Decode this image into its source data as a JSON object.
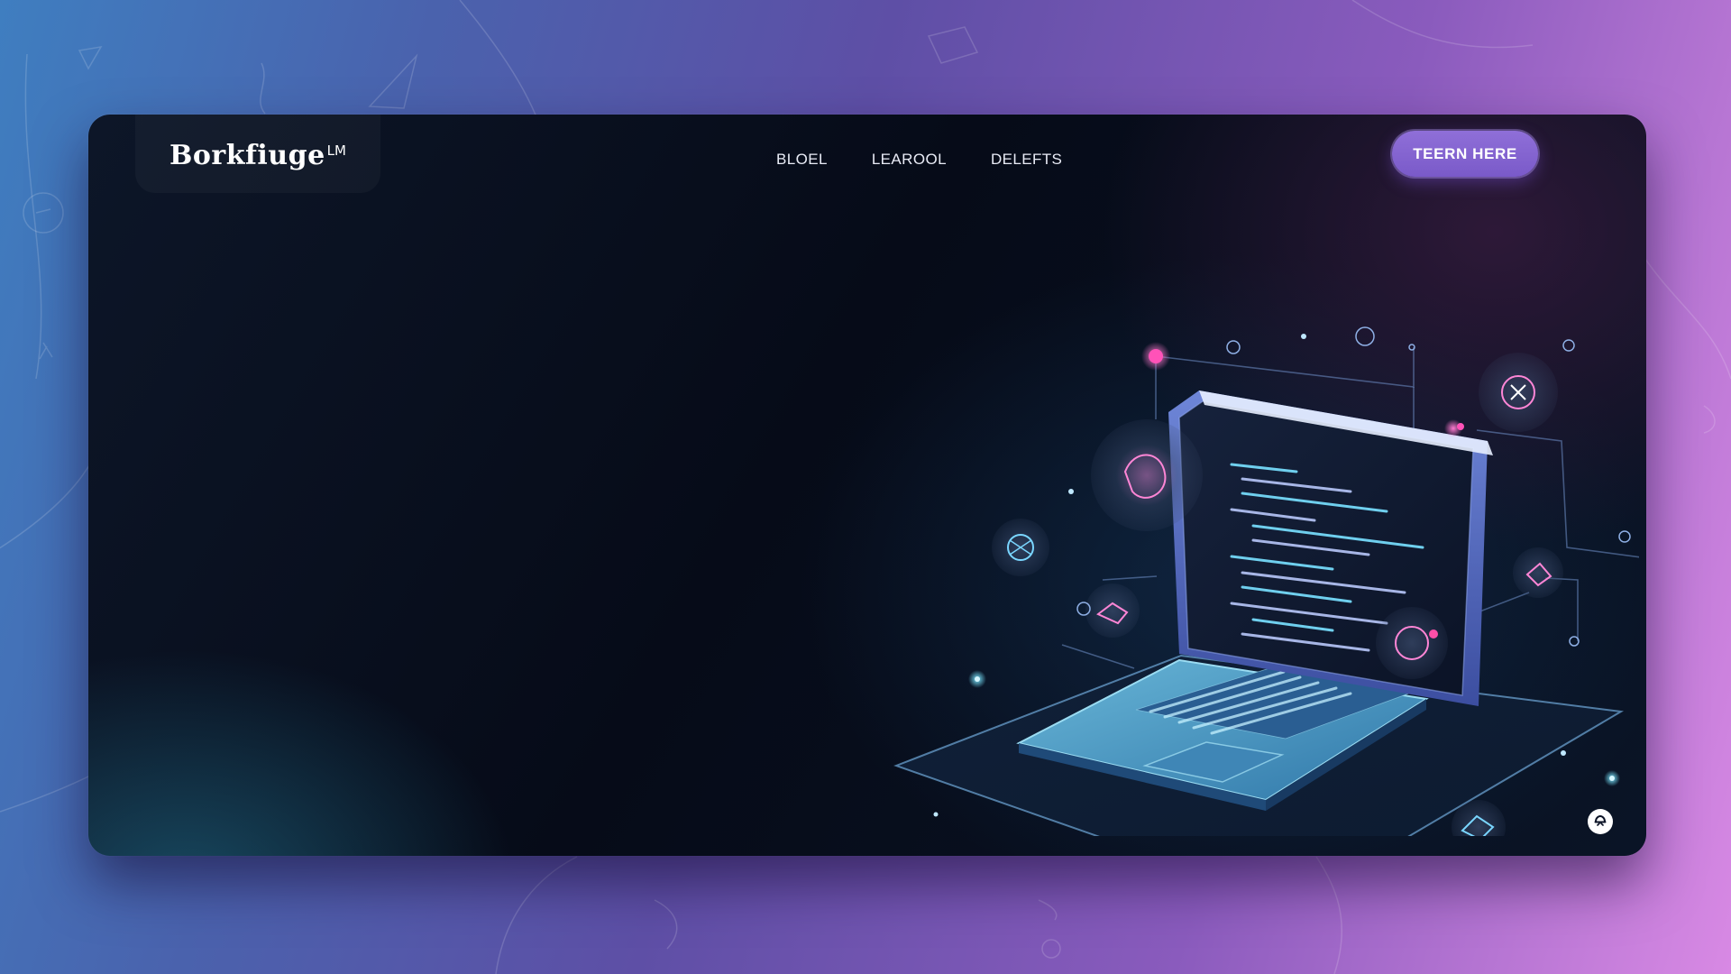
{
  "brand": {
    "name": "Borkfiuge",
    "superscript": "LM"
  },
  "nav": {
    "items": [
      {
        "label": "BLOEL"
      },
      {
        "label": "LEAROOL"
      },
      {
        "label": "DELEFTS"
      }
    ]
  },
  "cta": {
    "label": "TEERN HERE"
  },
  "icons": {
    "hero": "laptop-illustration",
    "corner": "chat-icon"
  },
  "colors": {
    "accent": "#7a5ac9",
    "background_from": "#3f7ec0",
    "background_to": "#d889e4",
    "window": "#060b18",
    "glow_pink": "#e0409e",
    "glow_cyan": "#5ad6f0"
  }
}
